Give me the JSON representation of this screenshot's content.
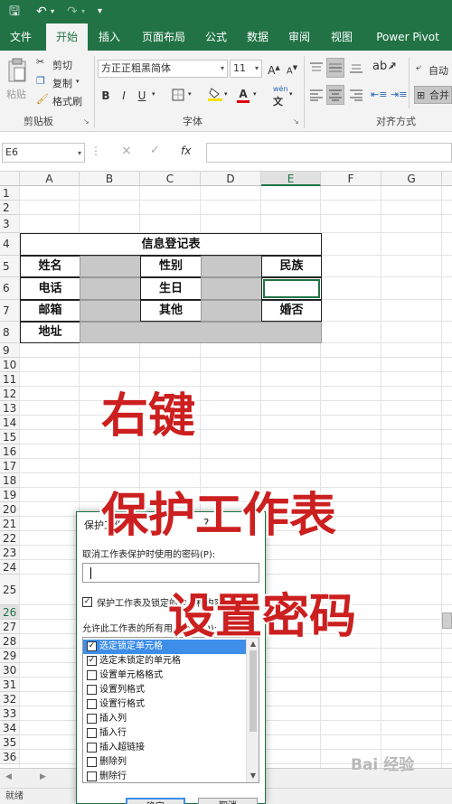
{
  "colors": {
    "accent": "#217346",
    "overlay": "#cc1f1f",
    "selection": "#3d8ee8",
    "merged_fill": "#c8c8c8"
  },
  "titlebar": {
    "icons": [
      "save-icon",
      "undo-icon",
      "redo-icon",
      "customize-quick-access-icon"
    ]
  },
  "tabs": [
    "文件",
    "开始",
    "插入",
    "页面布局",
    "公式",
    "数据",
    "审阅",
    "视图",
    "Power Pivot"
  ],
  "active_tab": "开始",
  "ribbon": {
    "clipboard": {
      "paste": "粘贴",
      "cut": "剪切",
      "copy": "复制",
      "format_painter": "格式刷",
      "label": "剪贴板"
    },
    "font": {
      "name": "方正正粗黑简体",
      "size": "11",
      "bold": "B",
      "italic": "I",
      "underline": "U",
      "phonetic": "wén",
      "label": "字体"
    },
    "alignment": {
      "wrap": "自动",
      "merge": "合并",
      "label": "对齐方式"
    }
  },
  "formula_bar": {
    "name_box": "E6",
    "cancel": "×",
    "enter": "✓",
    "fx": "fx",
    "content": ""
  },
  "columns": [
    "A",
    "B",
    "C",
    "D",
    "E",
    "F",
    "G"
  ],
  "selected_column": "E",
  "selected_row": "26",
  "rows": [
    "1",
    "2",
    "3",
    "4",
    "5",
    "6",
    "7",
    "8",
    "9",
    "10",
    "11",
    "12",
    "13",
    "14",
    "15",
    "16",
    "17",
    "18",
    "19",
    "20",
    "21",
    "22",
    "23",
    "24",
    "25",
    "26",
    "27",
    "28",
    "29",
    "30",
    "31",
    "32",
    "33",
    "34",
    "35",
    "36"
  ],
  "table": {
    "title": "信息登记表",
    "labels": {
      "name": "姓名",
      "gender": "性别",
      "ethnicity": "民族",
      "phone": "电话",
      "birthday": "生日",
      "email": "邮箱",
      "other": "其他",
      "married": "婚否",
      "address": "地址"
    }
  },
  "overlay": {
    "line1": "右键",
    "line2": "保护工作表",
    "line3": "设置密码"
  },
  "dialog": {
    "title": "保护工作表",
    "help": "?",
    "password_label": "取消工作表保护时使用的密码(P):",
    "password_value": "",
    "protect_label": "保护工作表及锁定的单元格内容",
    "allow_label": "允许此工作表的所有用户进行(O):",
    "permissions": [
      {
        "label": "选定锁定单元格",
        "checked": true
      },
      {
        "label": "选定未锁定的单元格",
        "checked": true
      },
      {
        "label": "设置单元格格式",
        "checked": false
      },
      {
        "label": "设置列格式",
        "checked": false
      },
      {
        "label": "设置行格式",
        "checked": false
      },
      {
        "label": "插入列",
        "checked": false
      },
      {
        "label": "插入行",
        "checked": false
      },
      {
        "label": "插入超链接",
        "checked": false
      },
      {
        "label": "删除列",
        "checked": false
      },
      {
        "label": "删除行",
        "checked": false
      }
    ],
    "ok": "确定",
    "cancel": "取消"
  },
  "status": {
    "ready": "就绪"
  },
  "watermark": "Bai 经验"
}
